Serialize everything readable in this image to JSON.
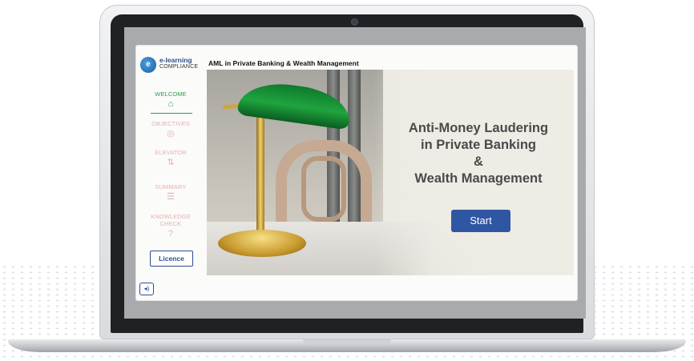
{
  "logo": {
    "line1": "e-learning",
    "line2": "COMPLIANCE",
    "mark": "e"
  },
  "course_title": "AML in Private Banking & Wealth Management",
  "nav": {
    "welcome": {
      "label": "WELCOME",
      "icon": "home-icon",
      "glyph": "⌂"
    },
    "objectives": {
      "label": "OBJECTIVES",
      "icon": "target-icon",
      "glyph": "◎"
    },
    "elevator": {
      "label": "ELEVATOR",
      "icon": "elevator-icon",
      "glyph": "⇅"
    },
    "summary": {
      "label": "SUMMARY",
      "icon": "list-icon",
      "glyph": "☰"
    },
    "knowledge_check_line1": "KNOWLEDGE",
    "knowledge_check_line2": "CHECK",
    "knowledge_check_icon": "question-icon",
    "knowledge_check_glyph": "?"
  },
  "licence_label": "Licence",
  "audio_icon": "speaker-icon",
  "audio_glyph": "◂)",
  "hero": {
    "line1": "Anti-Money Laudering",
    "line2": "in Private Banking",
    "line3": "&",
    "line4": "Wealth Management",
    "start_label": "Start"
  },
  "colors": {
    "active_nav": "#2e9b4a",
    "inactive_nav": "#e3b3ad",
    "brand_blue": "#2f56a3"
  }
}
